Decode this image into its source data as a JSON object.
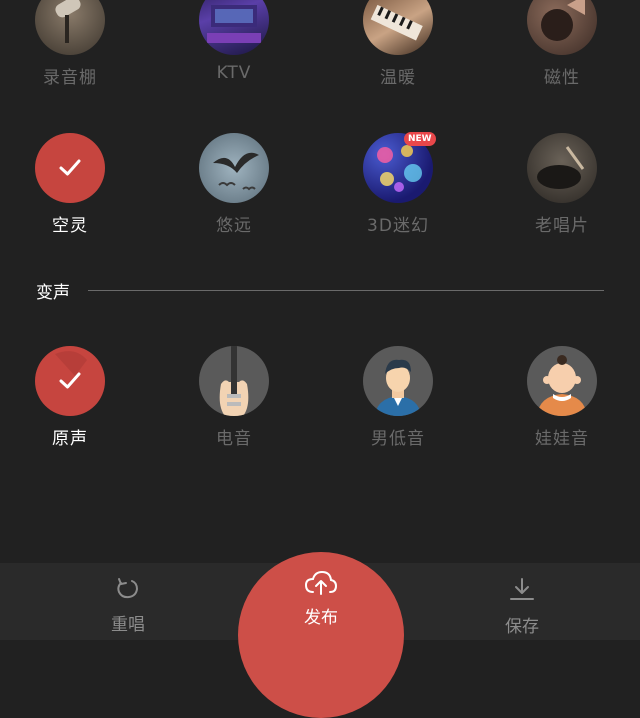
{
  "effects_row1": [
    {
      "label": "录音棚",
      "icon": "studio-microphone-thumbnail"
    },
    {
      "label": "KTV",
      "icon": "ktv-room-thumbnail"
    },
    {
      "label": "温暖",
      "icon": "piano-thumbnail"
    },
    {
      "label": "磁性",
      "icon": "gramophone-thumbnail"
    }
  ],
  "effects_row2": [
    {
      "label": "空灵",
      "icon": "checkmark-icon",
      "selected": true
    },
    {
      "label": "悠远",
      "icon": "bird-flying-thumbnail"
    },
    {
      "label": "3D迷幻",
      "icon": "bokeh-lights-thumbnail",
      "badge": "NEW"
    },
    {
      "label": "老唱片",
      "icon": "vinyl-record-thumbnail"
    }
  ],
  "voice_section": {
    "title": "变声"
  },
  "voice_changers": [
    {
      "label": "原声",
      "icon": "checkmark-icon",
      "selected": true
    },
    {
      "label": "电音",
      "icon": "electric-guitar-icon"
    },
    {
      "label": "男低音",
      "icon": "man-avatar-icon"
    },
    {
      "label": "娃娃音",
      "icon": "baby-avatar-icon"
    }
  ],
  "bottom_bar": {
    "retry_label": "重唱",
    "publish_label": "发布",
    "save_label": "保存"
  },
  "colors": {
    "background": "#212121",
    "accent": "#cd4f48",
    "muted_text": "#6a6a6a",
    "selected_text": "#ffffff"
  }
}
